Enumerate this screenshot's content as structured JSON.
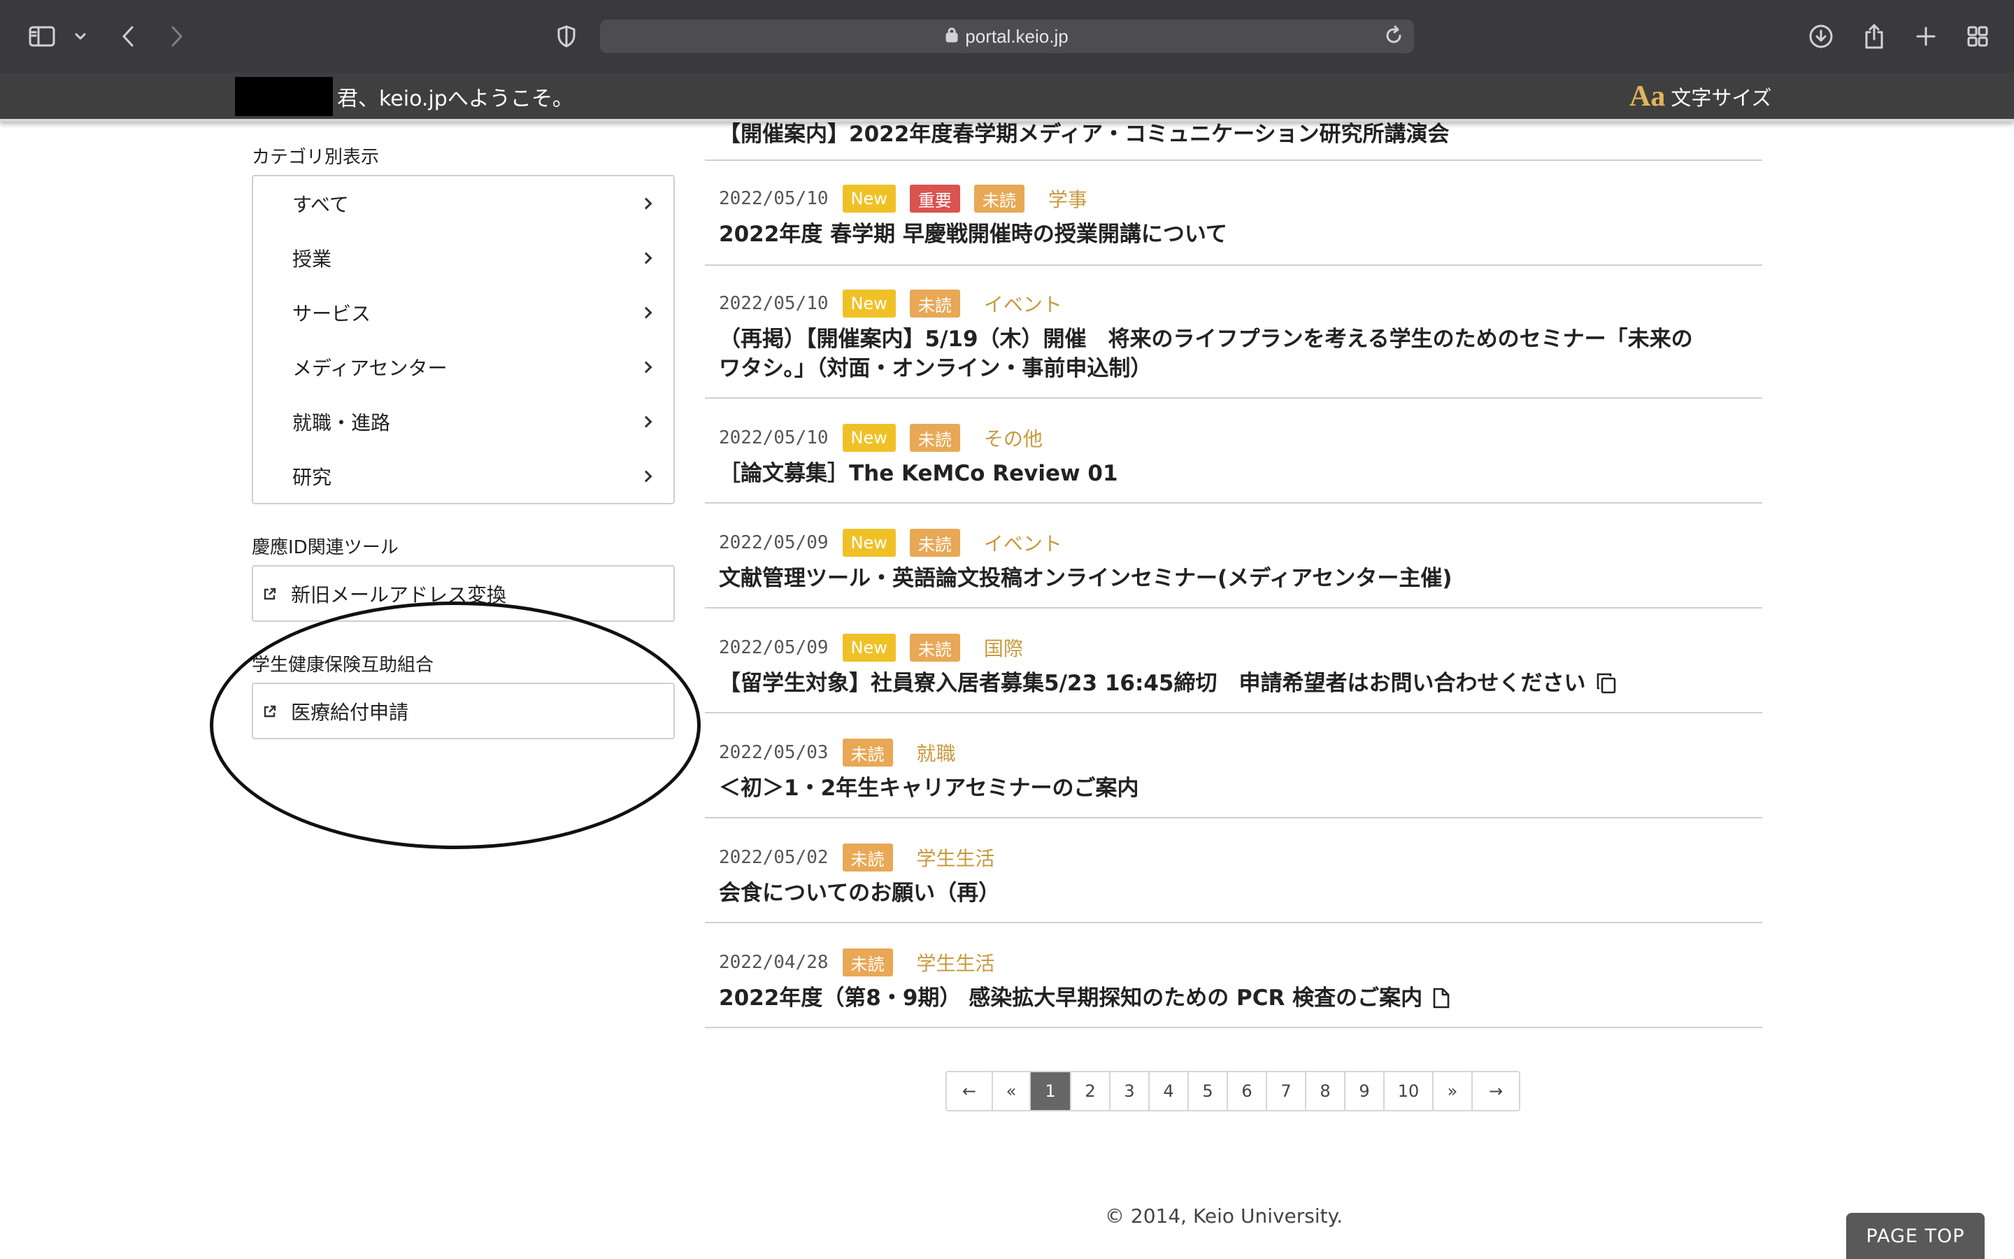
{
  "browser": {
    "url": "portal.keio.jp",
    "icons": [
      "sidebar-icon",
      "chevron-down-icon",
      "back-icon",
      "forward-icon",
      "privacy-shield-icon",
      "lock-icon",
      "reload-icon",
      "download-icon",
      "share-icon",
      "new-tab-icon",
      "tab-overview-icon"
    ]
  },
  "header": {
    "welcome": "君、keio.jpへようこそ。",
    "font_size_icon_text": "Aa",
    "font_size_label": "文字サイズ"
  },
  "sidebar": {
    "category_title": "カテゴリ別表示",
    "categories": [
      {
        "label": "すべて"
      },
      {
        "label": "授業"
      },
      {
        "label": "サービス"
      },
      {
        "label": "メディアセンター"
      },
      {
        "label": "就職・進路"
      },
      {
        "label": "研究"
      }
    ],
    "keio_id_title": "慶應ID関連ツール",
    "keio_id_tool": "新旧メールアドレス変換",
    "insurance_title": "学生健康保険互助組合",
    "insurance_tool": "医療給付申請"
  },
  "news": {
    "top_title": "【開催案内】2022年度春学期メディア・コミュニケーション研究所講演会",
    "items": [
      {
        "date": "2022/05/10",
        "badge_new": "New",
        "badge_important": "重要",
        "badge_unread": "未読",
        "category": "学事",
        "title": "2022年度 春学期 早慶戦開催時の授業開講について"
      },
      {
        "date": "2022/05/10",
        "badge_new": "New",
        "badge_unread": "未読",
        "category": "イベント",
        "title_line1": "（再掲）【開催案内】5/19（木）開催　将来のライフプランを考える学生のためのセミナー「未来の",
        "title_line2": "ワタシ。」（対面・オンライン・事前申込制）"
      },
      {
        "date": "2022/05/10",
        "badge_new": "New",
        "badge_unread": "未読",
        "category": "その他",
        "title": "［論文募集］The KeMCo Review 01"
      },
      {
        "date": "2022/05/09",
        "badge_new": "New",
        "badge_unread": "未読",
        "category": "イベント",
        "title": "文献管理ツール・英語論文投稿オンラインセミナー(メディアセンター主催)"
      },
      {
        "date": "2022/05/09",
        "badge_new": "New",
        "badge_unread": "未読",
        "category": "国際",
        "title": "【留学生対象】社員寮入居者募集5/23 16:45締切　申請希望者はお問い合わせください",
        "icon": "copy-icon"
      },
      {
        "date": "2022/05/03",
        "badge_unread": "未読",
        "category": "就職",
        "title": "＜初＞1・2年生キャリアセミナーのご案内"
      },
      {
        "date": "2022/05/02",
        "badge_unread": "未読",
        "category": "学生生活",
        "title": "会食についてのお願い（再）"
      },
      {
        "date": "2022/04/28",
        "badge_unread": "未読",
        "category": "学生生活",
        "title": "2022年度（第8・9期） 感染拡大早期探知のための PCR 検査のご案内",
        "icon": "document-icon"
      }
    ]
  },
  "pagination": {
    "first": "←",
    "prev": "«",
    "pages": [
      "1",
      "2",
      "3",
      "4",
      "5",
      "6",
      "7",
      "8",
      "9",
      "10"
    ],
    "current": "1",
    "next": "»",
    "last": "→"
  },
  "footer": {
    "copyright": "© 2014, Keio University.",
    "page_top": "PAGE TOP"
  },
  "colors": {
    "badge_new": "#f0c126",
    "badge_important": "#d9534f",
    "badge_unread": "#e8a856",
    "category_text": "#c89a3e",
    "header_bg": "#3f3f3f"
  }
}
